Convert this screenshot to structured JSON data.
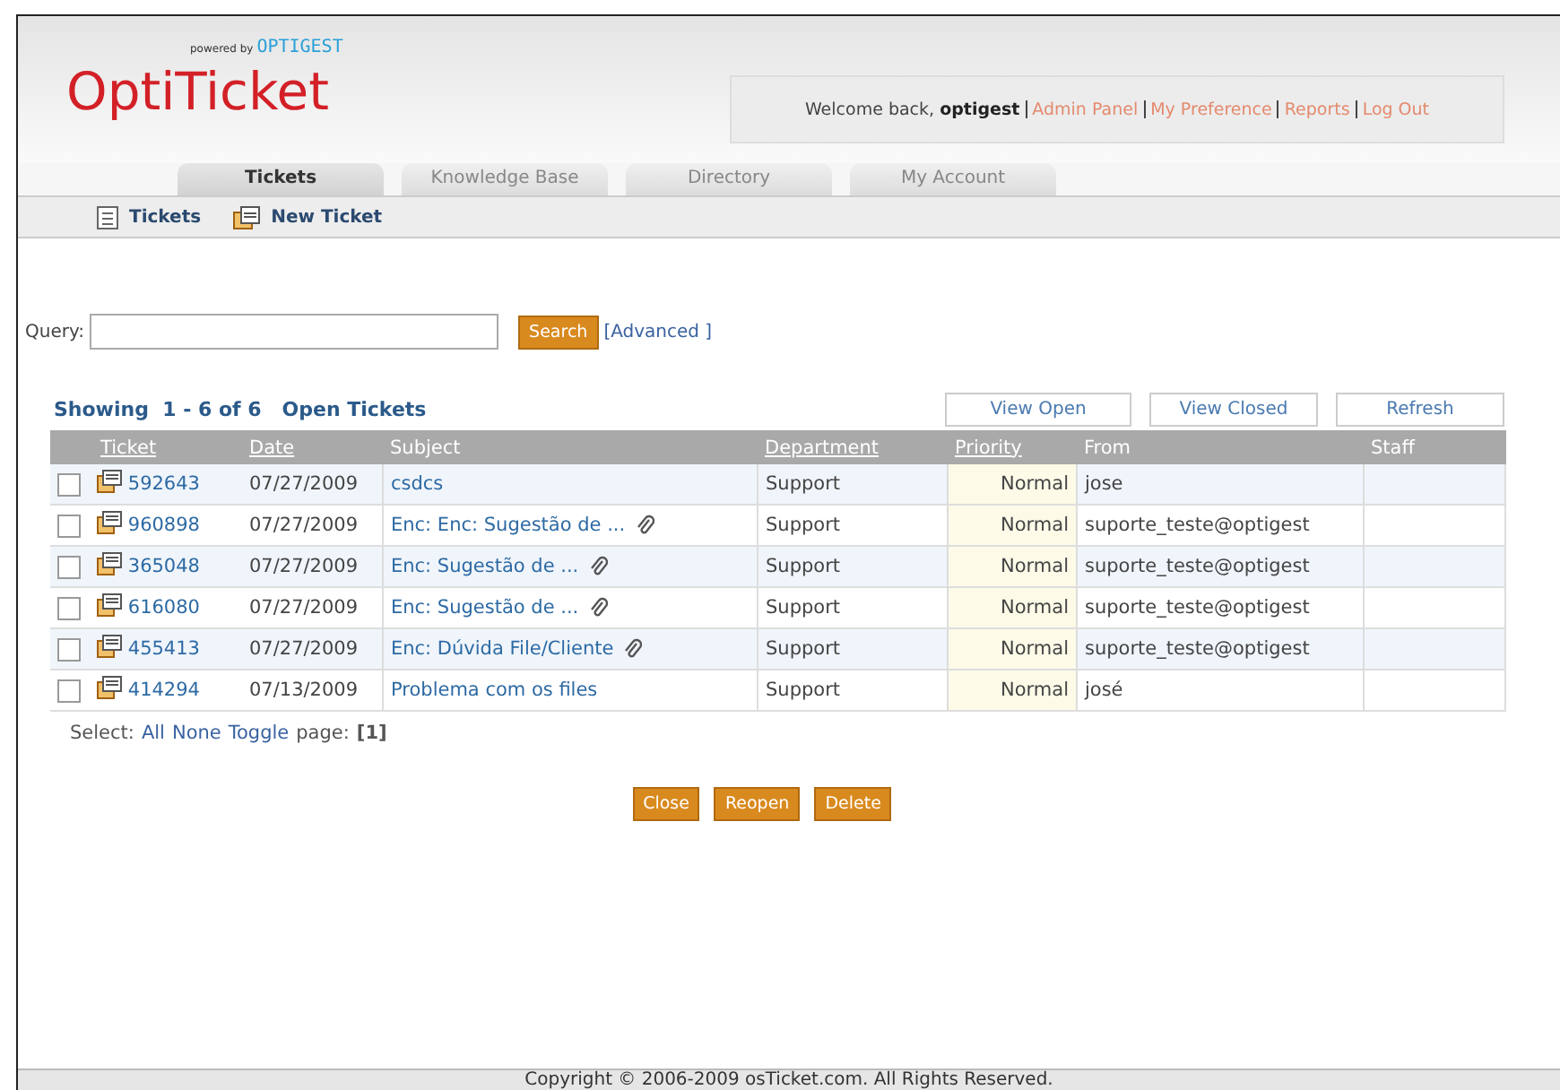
{
  "header": {
    "powered_by": "powered by",
    "powered_brand": "OPTIGEST",
    "logo": "OptiTicket",
    "welcome": "Welcome back,",
    "user": "optigest",
    "links": [
      "Admin Panel",
      "My Preference",
      "Reports",
      "Log Out"
    ]
  },
  "tabs": [
    {
      "label": "Tickets",
      "selected": true
    },
    {
      "label": "Knowledge Base",
      "selected": false
    },
    {
      "label": "Directory",
      "selected": false
    },
    {
      "label": "My Account",
      "selected": false
    }
  ],
  "subnav": [
    {
      "label": "Tickets",
      "kind": "list"
    },
    {
      "label": "New Ticket",
      "kind": "new"
    }
  ],
  "query": {
    "label": "Query:",
    "button": "Search",
    "advanced": "[Advanced ]"
  },
  "showing": "Showing  1 - 6 of 6   Open Tickets",
  "view_buttons": [
    "View Open",
    "View Closed",
    "Refresh"
  ],
  "table": {
    "columns": [
      {
        "label": "Ticket",
        "link": true
      },
      {
        "label": "Date",
        "link": true
      },
      {
        "label": "Subject",
        "link": false
      },
      {
        "label": "Department",
        "link": true
      },
      {
        "label": "Priority",
        "link": true
      },
      {
        "label": "From",
        "link": false
      },
      {
        "label": "Staff",
        "link": false
      }
    ],
    "rows": [
      {
        "checked": false,
        "ticket": "592643",
        "date": "07/27/2009",
        "subject": "csdcs",
        "attachment": false,
        "department": "Support",
        "priority": "Normal",
        "from": "jose"
      },
      {
        "checked": false,
        "ticket": "960898",
        "date": "07/27/2009",
        "subject": "Enc: Enc: Sugestão de ...",
        "attachment": true,
        "department": "Support",
        "priority": "Normal",
        "from": "suporte_teste@optigest"
      },
      {
        "checked": false,
        "ticket": "365048",
        "date": "07/27/2009",
        "subject": "Enc: Sugestão de ...",
        "attachment": true,
        "department": "Support",
        "priority": "Normal",
        "from": "suporte_teste@optigest"
      },
      {
        "checked": false,
        "ticket": "616080",
        "date": "07/27/2009",
        "subject": "Enc: Sugestão de ...",
        "attachment": true,
        "department": "Support",
        "priority": "Normal",
        "from": "suporte_teste@optigest"
      },
      {
        "checked": false,
        "ticket": "455413",
        "date": "07/27/2009",
        "subject": "Enc: Dúvida File/Cliente",
        "attachment": true,
        "department": "Support",
        "priority": "Normal",
        "from": "suporte_teste@optigest"
      },
      {
        "checked": false,
        "ticket": "414294",
        "date": "07/13/2009",
        "subject": "Problema com os files",
        "attachment": false,
        "department": "Support",
        "priority": "Normal",
        "from": "josé"
      }
    ]
  },
  "select": {
    "label": "Select:",
    "links": [
      "All",
      "None",
      "Toggle"
    ],
    "page_label": "page:",
    "page": "[1]"
  },
  "actions": [
    "Close",
    "Reopen",
    "Delete"
  ],
  "footer": "Copyright © 2006-2009 osTicket.com.  All Rights Reserved."
}
